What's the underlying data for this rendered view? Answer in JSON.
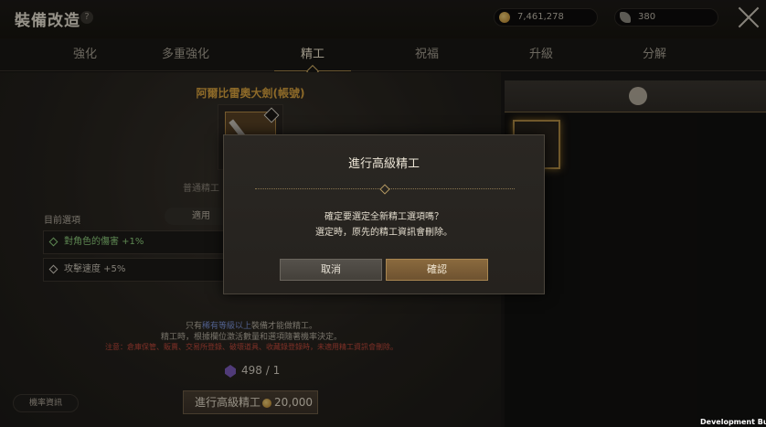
{
  "header": {
    "title": "裝備改造",
    "help_icon_text": "?",
    "gold_amount": "7,461,278",
    "feather_amount": "380"
  },
  "tabs": [
    {
      "label": "強化",
      "active": false
    },
    {
      "label": "多重強化",
      "active": false
    },
    {
      "label": "精工",
      "active": true
    },
    {
      "label": "祝福",
      "active": false
    },
    {
      "label": "升級",
      "active": false
    },
    {
      "label": "分解",
      "active": false
    }
  ],
  "item": {
    "name": "阿爾比雷奧大劍(帳號)",
    "refine_type_label": "普通精工"
  },
  "options": {
    "current_label": "目前選項",
    "use_button": "適用",
    "rows": [
      "對角色的傷害 +1%",
      "攻擊速度 +5%"
    ]
  },
  "notices": {
    "line1_pre": "只有",
    "line1_highlight": "稀有等級以上",
    "line1_post": "裝備才能做精工。",
    "line2": "精工時，根據欄位激活數量和選項隨著機率決定。",
    "line3": "注意：倉庫保管、販賣、交易所登錄、破壞道具、收藏錄登錄時，未適用精工資訊會刪除。"
  },
  "material": {
    "count": "498 / 1"
  },
  "buttons": {
    "rate_info": "機率資訊",
    "advanced_refine": "進行高級精工",
    "advanced_cost": "20,000"
  },
  "dialog": {
    "title": "進行高級精工",
    "message_line1": "確定要選定全新精工選項嗎？",
    "message_line2": "選定時，原先的精工資訊會刪除。",
    "cancel": "取消",
    "confirm": "確認"
  },
  "footer": {
    "build_label": "Development Build"
  }
}
